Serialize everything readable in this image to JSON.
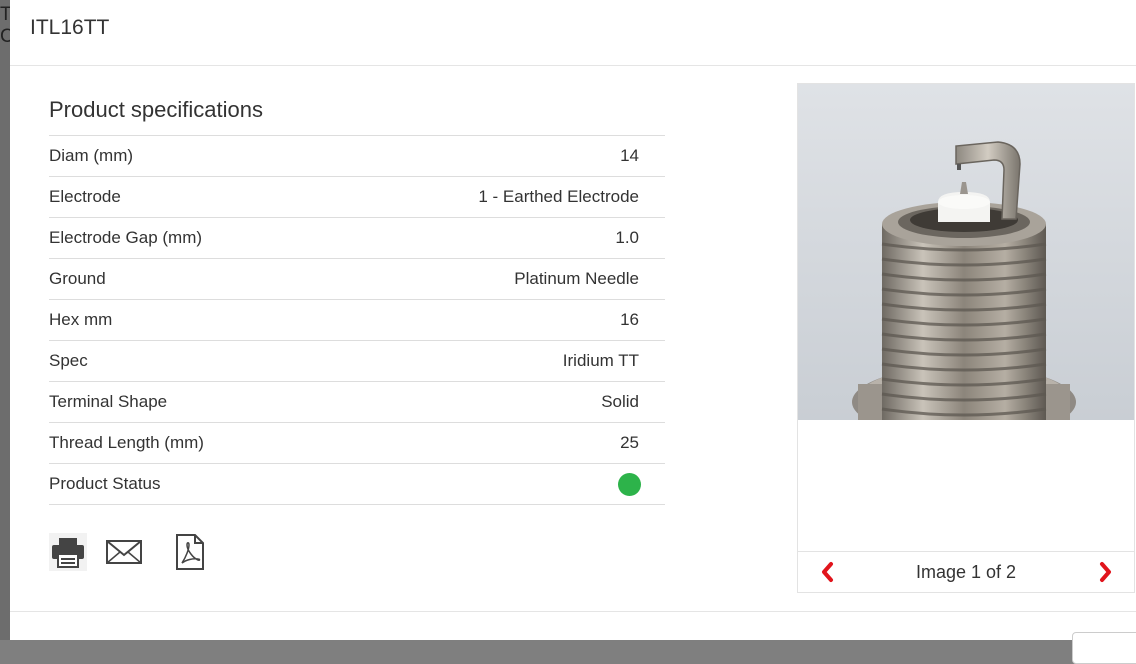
{
  "background": {
    "letters": "T\nC"
  },
  "modal": {
    "title": "ITL16TT"
  },
  "specs": {
    "heading": "Product specifications",
    "rows": [
      {
        "label": "Diam (mm)",
        "value": "14"
      },
      {
        "label": "Electrode",
        "value": "1 - Earthed Electrode"
      },
      {
        "label": "Electrode Gap (mm)",
        "value": "1.0"
      },
      {
        "label": "Ground",
        "value": "Platinum Needle"
      },
      {
        "label": "Hex mm",
        "value": "16"
      },
      {
        "label": "Spec",
        "value": "Iridium TT"
      },
      {
        "label": "Terminal Shape",
        "value": "Solid"
      },
      {
        "label": "Thread Length (mm)",
        "value": "25"
      },
      {
        "label": "Product Status",
        "value": ""
      }
    ],
    "status_color": "#2db34a"
  },
  "actions": {
    "icons": [
      "print-icon",
      "email-icon",
      "pdf-icon"
    ]
  },
  "gallery": {
    "counter": "Image 1 of 2",
    "current": 1,
    "total": 2,
    "arrow_color": "#e1141c"
  }
}
